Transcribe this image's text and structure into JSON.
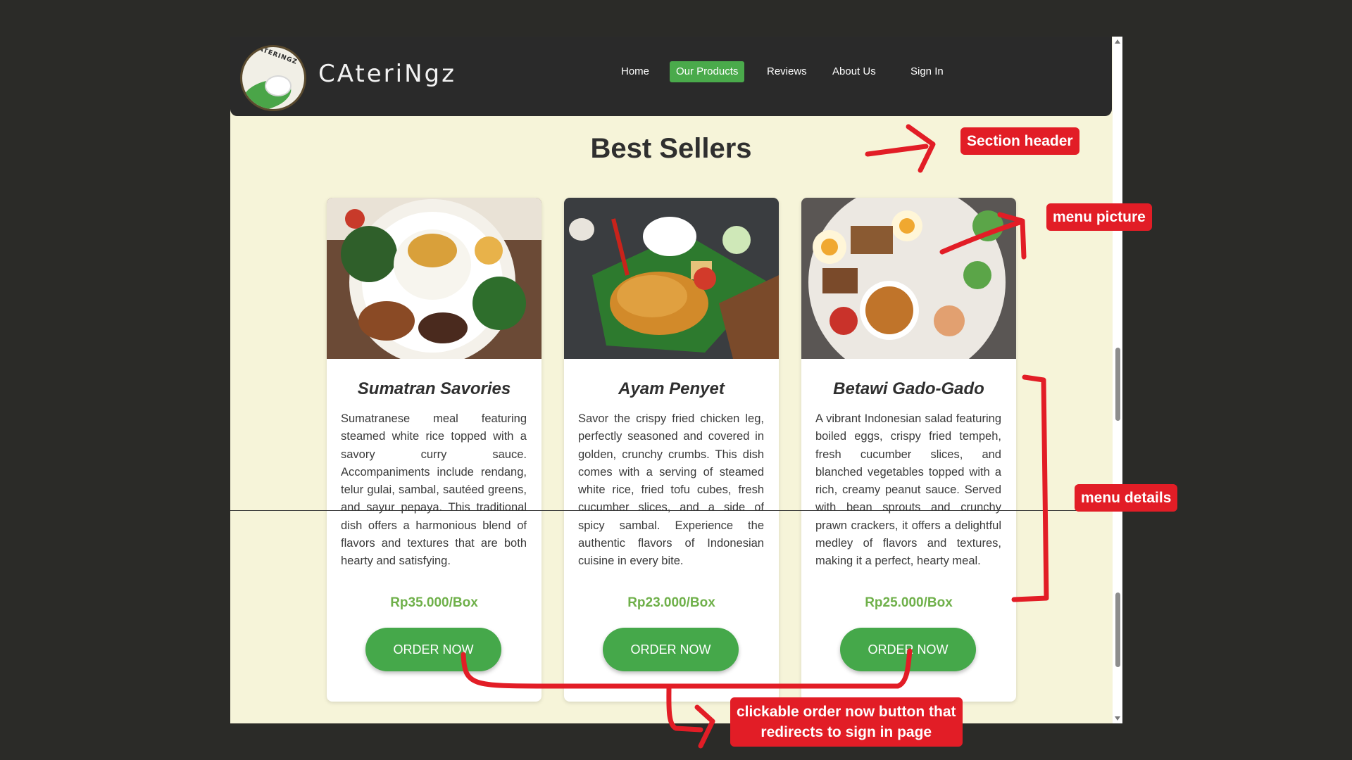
{
  "brand": {
    "name": "CAteriNgz",
    "logo_text": "CATERINGZ"
  },
  "nav": {
    "items": [
      {
        "label": "Home",
        "active": false
      },
      {
        "label": "Our Products",
        "active": true
      },
      {
        "label": "Reviews",
        "active": false
      },
      {
        "label": "About Us",
        "active": false
      },
      {
        "label": "Sign In",
        "active": false
      }
    ]
  },
  "section": {
    "title": "Best Sellers"
  },
  "cards": [
    {
      "title": "Sumatran Savories",
      "description": "Sumatranese meal featuring steamed white rice topped with a savory curry sauce. Accompaniments include rendang, telur gulai, sambal, sautéed greens, and sayur pepaya. This traditional dish offers a harmonious blend of flavors and textures that are both hearty and satisfying.",
      "price": "Rp35.000/Box",
      "button": "ORDER NOW"
    },
    {
      "title": "Ayam Penyet",
      "description": "Savor the crispy fried chicken leg, perfectly seasoned and covered in golden, crunchy crumbs. This dish comes with a serving of steamed white rice, fried tofu cubes, fresh cucumber slices, and a side of spicy sambal. Experience the authentic flavors of Indonesian cuisine in every bite.",
      "price": "Rp23.000/Box",
      "button": "ORDER NOW"
    },
    {
      "title": "Betawi Gado-Gado",
      "description": "A vibrant Indonesian salad featuring boiled eggs, crispy fried tempeh, fresh cucumber slices, and blanched vegetables topped with a rich, creamy peanut sauce. Served with bean sprouts and crunchy prawn crackers, it offers a delightful medley of flavors and textures, making it a perfect, hearty meal.",
      "price": "Rp25.000/Box",
      "button": "ORDER NOW"
    }
  ],
  "annotations": {
    "section_header": "Section header",
    "menu_picture": "menu picture",
    "menu_details": "menu details",
    "order_button_line1": "clickable order now button that",
    "order_button_line2": "redirects to sign in page"
  },
  "colors": {
    "accent_green": "#4aaa4b",
    "price_green": "#6fb04a",
    "annotation_red": "#e21d26",
    "page_background": "#f6f4d9",
    "navbar": "#2a2a2a"
  }
}
